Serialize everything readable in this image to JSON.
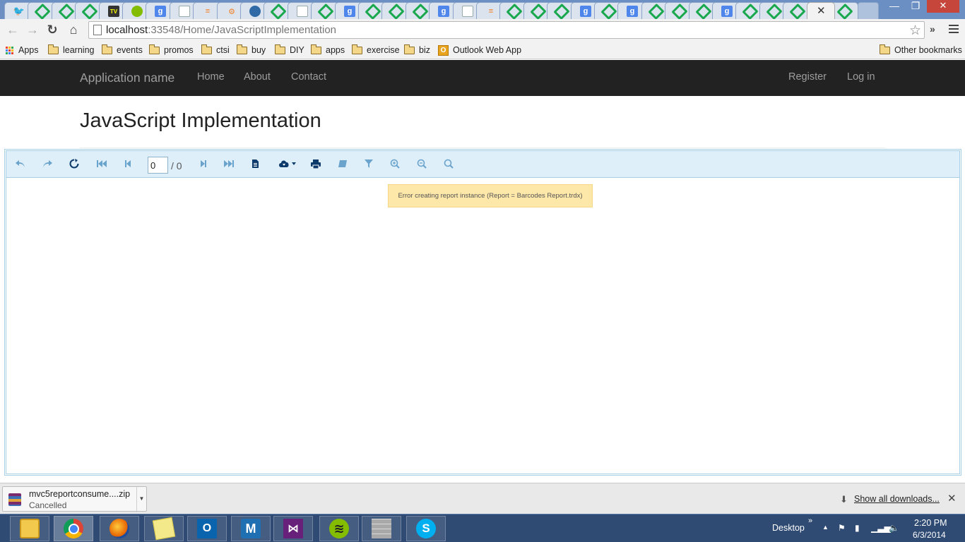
{
  "browser": {
    "tabs": [
      {
        "favicon": "twitter-icon",
        "glyph": "🐦",
        "cls": "tw"
      },
      {
        "favicon": "green-diamond-icon",
        "glyph": "",
        "cls": "gr"
      },
      {
        "favicon": "green-diamond-icon",
        "glyph": "",
        "cls": "gr"
      },
      {
        "favicon": "green-diamond-icon",
        "glyph": "",
        "cls": "gr"
      },
      {
        "favicon": "tv-icon",
        "glyph": "TV",
        "cls": "tv"
      },
      {
        "favicon": "spotify-icon",
        "glyph": "",
        "cls": "sp"
      },
      {
        "favicon": "google-icon",
        "glyph": "g",
        "cls": "g"
      },
      {
        "favicon": "blank-page-icon",
        "glyph": "",
        "cls": "doc"
      },
      {
        "favicon": "stackoverflow-icon",
        "glyph": "≡",
        "cls": "so"
      },
      {
        "favicon": "gear-favicon-icon",
        "glyph": "⚙",
        "cls": "so"
      },
      {
        "favicon": "database-icon",
        "glyph": "",
        "cls": "db"
      },
      {
        "favicon": "green-diamond-icon",
        "glyph": "",
        "cls": "gr"
      },
      {
        "favicon": "document-icon",
        "glyph": "",
        "cls": "doc"
      },
      {
        "favicon": "green-diamond-icon",
        "glyph": "",
        "cls": "gr"
      },
      {
        "favicon": "google-icon",
        "glyph": "g",
        "cls": "g"
      },
      {
        "favicon": "green-diamond-icon",
        "glyph": "",
        "cls": "gr"
      },
      {
        "favicon": "green-diamond-icon",
        "glyph": "",
        "cls": "gr"
      },
      {
        "favicon": "green-diamond-icon",
        "glyph": "",
        "cls": "gr"
      },
      {
        "favicon": "google-icon",
        "glyph": "g",
        "cls": "g"
      },
      {
        "favicon": "document-icon",
        "glyph": "",
        "cls": "doc"
      },
      {
        "favicon": "stackoverflow-icon",
        "glyph": "≡",
        "cls": "so"
      },
      {
        "favicon": "green-diamond-icon",
        "glyph": "",
        "cls": "gr"
      },
      {
        "favicon": "green-diamond-icon",
        "glyph": "",
        "cls": "gr"
      },
      {
        "favicon": "green-diamond-icon",
        "glyph": "",
        "cls": "gr"
      },
      {
        "favicon": "google-icon",
        "glyph": "g",
        "cls": "g"
      },
      {
        "favicon": "green-diamond-icon",
        "glyph": "",
        "cls": "gr"
      },
      {
        "favicon": "google-icon",
        "glyph": "g",
        "cls": "g"
      },
      {
        "favicon": "green-diamond-icon",
        "glyph": "",
        "cls": "gr"
      },
      {
        "favicon": "green-diamond-icon",
        "glyph": "",
        "cls": "gr"
      },
      {
        "favicon": "green-diamond-icon",
        "glyph": "",
        "cls": "gr"
      },
      {
        "favicon": "google-icon",
        "glyph": "g",
        "cls": "g"
      },
      {
        "favicon": "green-diamond-icon",
        "glyph": "",
        "cls": "gr"
      },
      {
        "favicon": "green-diamond-icon",
        "glyph": "",
        "cls": "gr"
      },
      {
        "favicon": "green-diamond-icon",
        "glyph": "",
        "cls": "gr"
      }
    ],
    "active_tab_close": "✕",
    "url_host": "localhost",
    "url_path": ":33548/Home/JavaScriptImplementation",
    "window_controls": {
      "minimize": "—",
      "restore": "❐",
      "close": "✕"
    }
  },
  "bookmarks": {
    "apps_label": "Apps",
    "folders": [
      "learning",
      "events",
      "promos",
      "ctsi",
      "buy",
      "DIY",
      "apps",
      "exercise",
      "biz"
    ],
    "outlook_label": "Outlook Web App",
    "other_label": "Other bookmarks"
  },
  "site": {
    "brand": "Application name",
    "nav_left": [
      "Home",
      "About",
      "Contact"
    ],
    "nav_right": [
      "Register",
      "Log in"
    ],
    "page_title": "JavaScript Implementation"
  },
  "viewer": {
    "page_value": "0",
    "page_total": "/ 0",
    "error_message": "Error creating report instance (Report = Barcodes Report.trdx)"
  },
  "downloads": {
    "file_name": "mvc5reportconsume....zip",
    "status": "Cancelled",
    "show_all": "Show all downloads..."
  },
  "taskbar": {
    "desktop_label": "Desktop",
    "time": "2:20 PM",
    "date": "6/3/2014"
  },
  "colors": {
    "navbar_bg": "#222222",
    "navbar_text": "#9d9d9d",
    "viewer_toolbar_bg": "#deeffa",
    "error_bg": "#fde7a9",
    "taskbar_bg": "#2f4b73"
  }
}
